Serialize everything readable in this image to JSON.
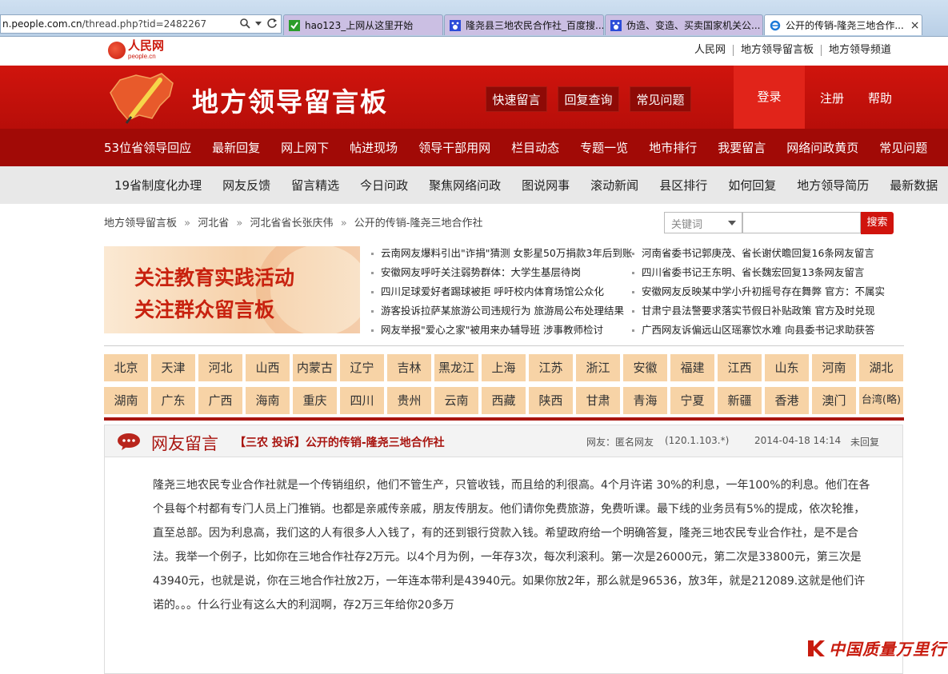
{
  "browser": {
    "address_domain": "n.people.com.cn",
    "address_path": "/thread.php?tid=2482267",
    "tabs": [
      {
        "label": "hao123_上网从这里开始"
      },
      {
        "label": "隆尧县三地农民合作社_百度搜..."
      },
      {
        "label": "伪造、变造、买卖国家机关公..."
      },
      {
        "label": "公开的传销-隆尧三地合作..."
      }
    ],
    "close_glyph": "×"
  },
  "util_bar": {
    "logo_text": "人民网",
    "logo_sub": "people.cn",
    "links": [
      "人民网",
      "地方领导留言板",
      "地方领导频道"
    ]
  },
  "header": {
    "title": "地方领导留言板",
    "buttons": [
      "快速留言",
      "回复查询",
      "常见问题"
    ],
    "login": "登录",
    "register": "注册",
    "help": "帮助"
  },
  "nav_main": [
    "53位省领导回应",
    "最新回复",
    "网上网下",
    "帖进现场",
    "领导干部用网",
    "栏目动态",
    "专题一览",
    "地市排行",
    "我要留言",
    "网络问政黄页",
    "常见问题"
  ],
  "nav_sub": [
    "19省制度化办理",
    "网友反馈",
    "留言精选",
    "今日问政",
    "聚焦网络问政",
    "图说网事",
    "滚动新闻",
    "县区排行",
    "如何回复",
    "地方领导简历",
    "最新数据"
  ],
  "breadcrumb": [
    "地方领导留言板",
    "河北省",
    "河北省省长张庆伟",
    "公开的传销-隆尧三地合作社"
  ],
  "breadcrumb_sep": "»",
  "search": {
    "select_label": "关键词",
    "button": "搜索"
  },
  "promo": {
    "line1": "关注教育实践活动",
    "line2": "关注群众留言板"
  },
  "news_left": [
    "云南网友爆料引出\"诈捐\"猜测 女影星50万捐款3年后到账",
    "安徽网友呼吁关注弱势群体：大学生基层待岗",
    "四川足球爱好者踢球被拒 呼吁校内体育场馆公众化",
    "游客投诉拉萨某旅游公司违规行为 旅游局公布处理结果",
    "网友举报\"爱心之家\"被用来办辅导班 涉事教师检讨"
  ],
  "news_right": [
    "河南省委书记郭庚茂、省长谢伏瞻回复16条网友留言",
    "四川省委书记王东明、省长魏宏回复13条网友留言",
    "安徽网友反映某中学小升初摇号存在舞弊 官方：不属实",
    "甘肃宁县法警要求落实节假日补贴政策 官方及时兑现",
    "广西网友诉偏远山区瑶寨饮水难 向县委书记求助获答"
  ],
  "provinces_row1": [
    "北京",
    "天津",
    "河北",
    "山西",
    "内蒙古",
    "辽宁",
    "吉林",
    "黑龙江",
    "上海",
    "江苏",
    "浙江",
    "安徽",
    "福建",
    "江西",
    "山东",
    "河南",
    "湖北"
  ],
  "provinces_row2": [
    "湖南",
    "广东",
    "广西",
    "海南",
    "重庆",
    "四川",
    "贵州",
    "云南",
    "西藏",
    "陕西",
    "甘肃",
    "青海",
    "宁夏",
    "新疆",
    "香港",
    "澳门",
    "台湾(略)"
  ],
  "message": {
    "section": "网友留言",
    "title": "【三农 投诉】公开的传销-隆尧三地合作社",
    "author": "网友：匿名网友",
    "ip": "(120.1.103.*)",
    "date": "2014-04-18 14:14",
    "status": "未回复",
    "body": "隆尧三地农民专业合作社就是一个传销组织，他们不管生产，只管收钱，而且给的利很高。4个月许诺 30%的利息，一年100%的利息。他们在各个县每个村都有专门人员上门推销。也都是亲戚传亲戚，朋友传朋友。他们请你免费旅游，免费听课。最下线的业务员有5%的提成，依次轮推，直至总部。因为利息高，我们这的人有很多人入钱了，有的还到银行贷款入钱。希望政府给一个明确答复，隆尧三地农民专业合作社，是不是合法。我举一个例子，比如你在三地合作社存2万元。以4个月为例，一年存3次，每次利滚利。第一次是26000元，第二次是33800元，第三次是43940元，也就是说，你在三地合作社放2万，一年连本带利是43940元。如果你放2年，那么就是96536，放3年，就是212089.这就是他们许诺的。。。什么行业有这么大的利润啊，存2万三年给你20多万"
  },
  "watermark": "中国质量万里行",
  "colors": {
    "brand_red": "#d0140d",
    "nav_red": "#a10a06",
    "province_bg": "#f7d3a6",
    "title_red": "#a91510"
  }
}
